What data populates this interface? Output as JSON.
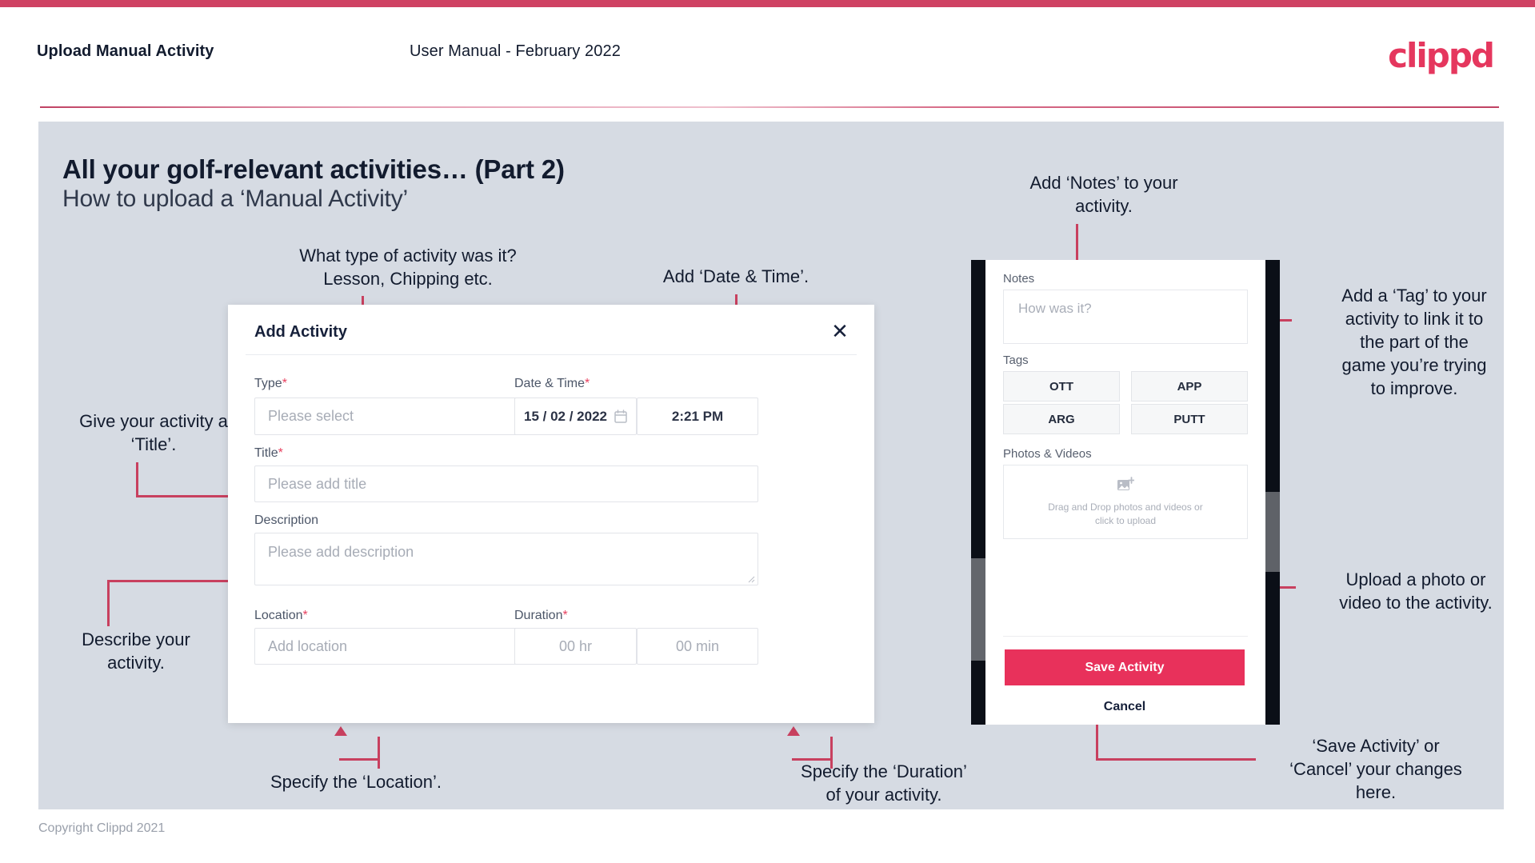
{
  "header": {
    "left_title": "Upload Manual Activity",
    "center_title": "User Manual - February 2022",
    "brand": "clippd",
    "accent_color": "#cf4263"
  },
  "slide": {
    "title": "All your golf-relevant activities… (Part 2)",
    "subtitle": "How to upload a ‘Manual Activity’",
    "background_color": "#d6dbe3"
  },
  "dialog": {
    "title": "Add Activity",
    "close_icon": "close-icon",
    "fields": {
      "type": {
        "label": "Type",
        "required": "*",
        "placeholder": "Please select",
        "chevron": "chevron-down-icon"
      },
      "datetime": {
        "label": "Date & Time",
        "required": "*",
        "date_value": "15 / 02 / 2022",
        "calendar_icon": "calendar-icon",
        "time_value": "2:21 PM"
      },
      "title": {
        "label": "Title",
        "required": "*",
        "placeholder": "Please add title"
      },
      "description": {
        "label": "Description",
        "required": "",
        "placeholder": "Please add description"
      },
      "location": {
        "label": "Location",
        "required": "*",
        "placeholder": "Add location"
      },
      "duration": {
        "label": "Duration",
        "required": "*",
        "hours_placeholder": "00 hr",
        "minutes_placeholder": "00 min"
      }
    }
  },
  "phone": {
    "notes": {
      "label": "Notes",
      "placeholder": "How was it?"
    },
    "tags": {
      "label": "Tags",
      "items": [
        "OTT",
        "APP",
        "ARG",
        "PUTT"
      ]
    },
    "photos": {
      "label": "Photos & Videos",
      "icon": "add-image-icon",
      "drop_text": "Drag and Drop photos and videos or\nclick to upload"
    },
    "save_label": "Save Activity",
    "cancel_label": "Cancel",
    "save_color": "#e8315b"
  },
  "annotations": {
    "type": "What type of activity was it?\nLesson, Chipping etc.",
    "datetime": "Add ‘Date & Time’.",
    "notes": "Add ‘Notes’ to your\nactivity.",
    "tag": "Add a ‘Tag’ to your\nactivity to link it to\nthe part of the\ngame you’re trying\nto improve.",
    "title": "Give your activity a\n‘Title’.",
    "description": "Describe your\nactivity.",
    "location": "Specify the ‘Location’.",
    "duration": "Specify the ‘Duration’\nof your activity.",
    "upload": "Upload a photo or\nvideo to the activity.",
    "save_cancel": "‘Save Activity’ or\n‘Cancel’ your changes\nhere."
  },
  "footer": {
    "copyright": "Copyright Clippd 2021"
  }
}
